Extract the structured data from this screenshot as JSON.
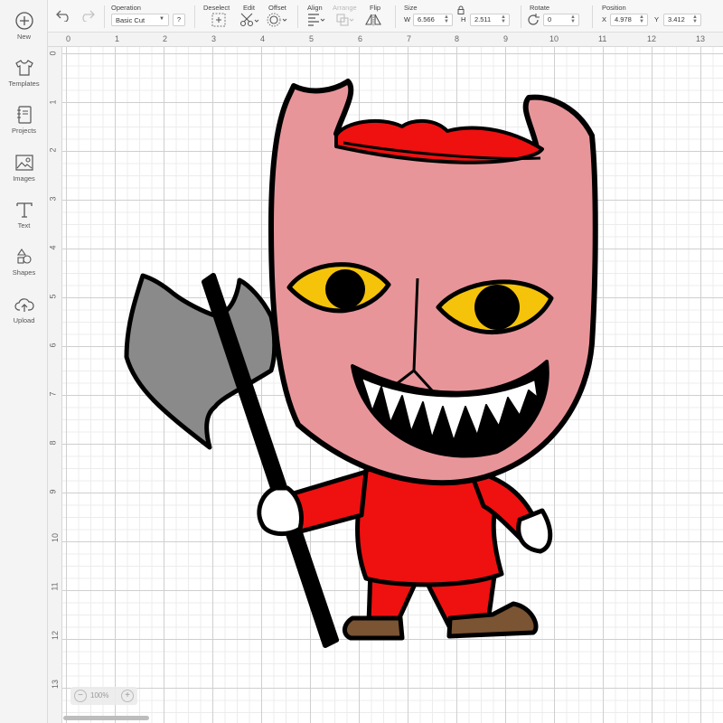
{
  "sidebar": {
    "items": [
      {
        "label": "New",
        "icon": "plus-circle-icon"
      },
      {
        "label": "Templates",
        "icon": "shirt-icon"
      },
      {
        "label": "Projects",
        "icon": "notebook-icon"
      },
      {
        "label": "Images",
        "icon": "image-icon"
      },
      {
        "label": "Text",
        "icon": "text-t-icon"
      },
      {
        "label": "Shapes",
        "icon": "shapes-icon"
      },
      {
        "label": "Upload",
        "icon": "cloud-upload-icon"
      }
    ]
  },
  "toolbar": {
    "operation": {
      "title": "Operation",
      "value": "Basic Cut",
      "help": "?"
    },
    "deselect": {
      "title": "Deselect"
    },
    "edit": {
      "title": "Edit"
    },
    "offset": {
      "title": "Offset"
    },
    "align": {
      "title": "Align"
    },
    "arrange": {
      "title": "Arrange"
    },
    "flip": {
      "title": "Flip"
    },
    "size": {
      "title": "Size",
      "w_label": "W",
      "w_value": "6.566",
      "h_label": "H",
      "h_value": "2.511"
    },
    "rotate": {
      "title": "Rotate",
      "value": "0"
    },
    "position": {
      "title": "Position",
      "x_label": "X",
      "x_value": "4.978",
      "y_label": "Y",
      "y_value": "3.412"
    }
  },
  "rulers": {
    "top": [
      "0",
      "1",
      "2",
      "3",
      "4",
      "5",
      "6",
      "7",
      "8",
      "9",
      "10",
      "11",
      "12",
      "13"
    ],
    "left": [
      "0",
      "1",
      "2",
      "3",
      "4",
      "5",
      "6",
      "7",
      "8",
      "9",
      "10",
      "11",
      "12",
      "13"
    ]
  },
  "zoom": {
    "minus": "−",
    "value": "100%",
    "plus": "+"
  },
  "colors": {
    "mask": "#e8959a",
    "suit": "#ef1010",
    "eyes": "#f5c30a",
    "axe": "#8a8a8a",
    "shoes": "#7a5433",
    "outline": "#000000"
  }
}
